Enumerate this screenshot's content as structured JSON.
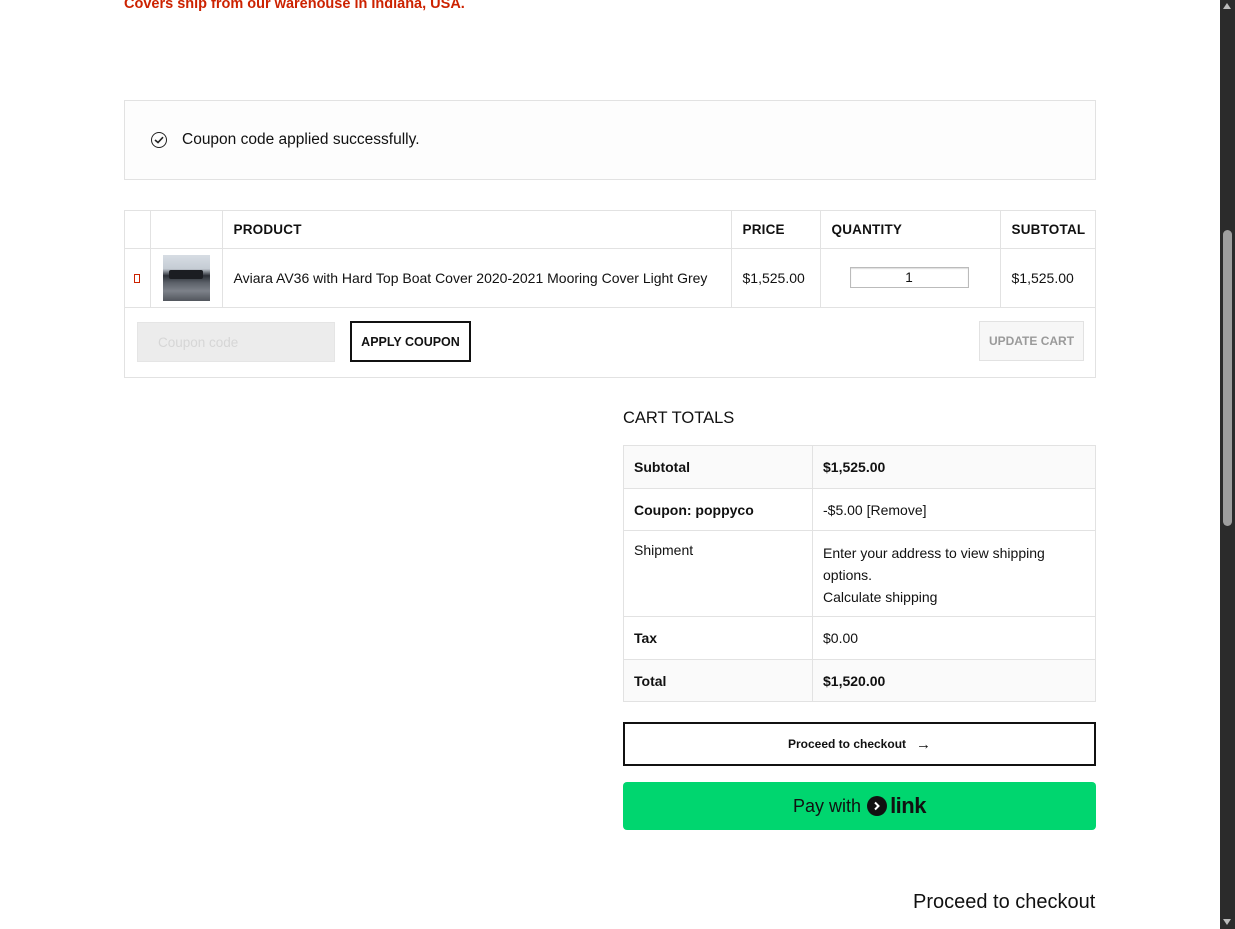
{
  "notice": {
    "text": "Covers ship from our warehouse in Indiana, USA."
  },
  "message": {
    "icon": "check-circle-icon",
    "text": "Coupon code applied successfully."
  },
  "cart": {
    "headers": {
      "product": "PRODUCT",
      "price": "PRICE",
      "quantity": "QUANTITY",
      "subtotal": "SUBTOTAL"
    },
    "items": [
      {
        "name": "Aviara AV36 with Hard Top Boat Cover 2020-2021 Mooring Cover Light Grey",
        "price": "$1,525.00",
        "quantity": "1",
        "subtotal": "$1,525.00"
      }
    ],
    "coupon_placeholder": "Coupon code",
    "apply_label": "APPLY COUPON",
    "update_label": "UPDATE CART"
  },
  "totals": {
    "title": "CART TOTALS",
    "subtotal_label": "Subtotal",
    "subtotal_value": "$1,525.00",
    "coupon_label": "Coupon: poppyco",
    "coupon_value": "-$5.00",
    "coupon_remove": "[Remove]",
    "shipment_label": "Shipment",
    "shipment_line1": "Enter your address to view shipping",
    "shipment_line2": "options.",
    "shipment_calc": "Calculate shipping",
    "tax_label": "Tax",
    "tax_value": "$0.00",
    "total_label": "Total",
    "total_value": "$1,520.00"
  },
  "checkout": {
    "label": "Proceed to checkout",
    "arrow": "→"
  },
  "link_pay": {
    "pay_text": "Pay with",
    "brand": "link",
    "brand_color": "#00d66f"
  },
  "bottom_heading": "Proceed to checkout"
}
